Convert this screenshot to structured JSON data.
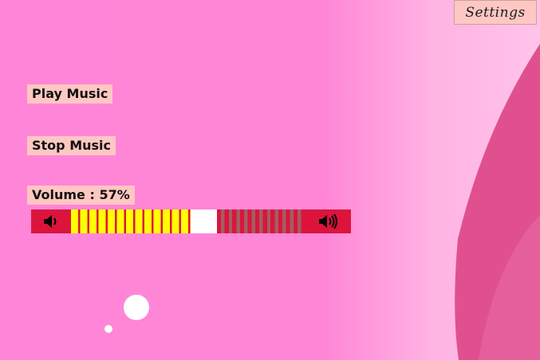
{
  "header": {
    "settings_label": "Settings"
  },
  "controls": {
    "play_label": "Play Music",
    "stop_label": "Stop Music",
    "volume_label": "Volume : 57%",
    "volume_level_percent": 57
  },
  "icons": {
    "volume_down": "speaker-low-icon",
    "volume_up": "speaker-high-icon"
  },
  "colors": {
    "background": "#ff86d6",
    "accent_shape": "#e0508f",
    "button_bg": "#ffc7c2",
    "slider_red": "#dc143c",
    "slider_fill": "#ffff00",
    "slider_thumb": "#ffffff",
    "slider_empty": "#a06060"
  }
}
